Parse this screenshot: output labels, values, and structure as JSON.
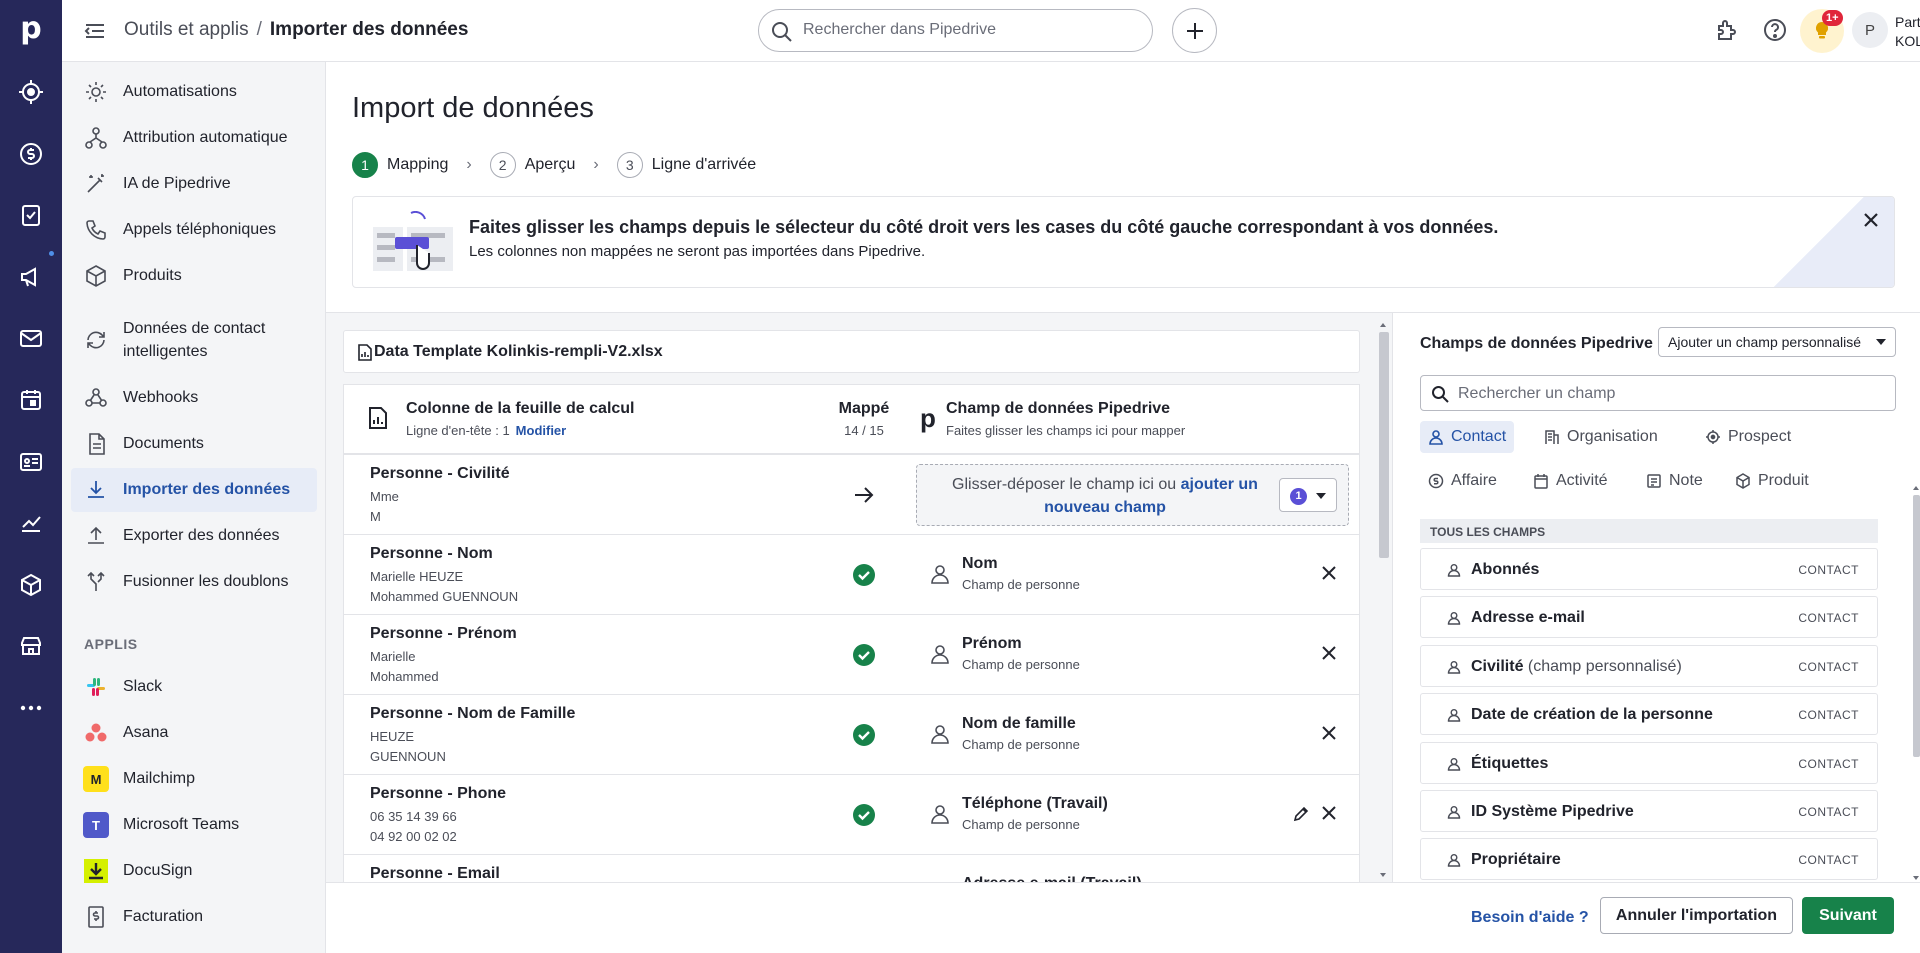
{
  "app": {
    "logo": "p"
  },
  "topbar": {
    "breadcrumb_parent": "Outils et applis",
    "breadcrumb_sep": "/",
    "breadcrumb_current": "Importer des données",
    "search_placeholder": "Rechercher dans Pipedrive",
    "notification_badge": "1+",
    "avatar_initial": "P",
    "user_line1": "Partner",
    "user_line2": "KOLINKIS"
  },
  "sidebar": {
    "items": [
      {
        "label": "Automatisations",
        "icon": "automation-icon"
      },
      {
        "label": "Attribution automatique",
        "icon": "assignment-icon"
      },
      {
        "label": "IA de Pipedrive",
        "icon": "magic-wand-icon"
      },
      {
        "label": "Appels téléphoniques",
        "icon": "phone-icon"
      },
      {
        "label": "Produits",
        "icon": "box-icon"
      },
      {
        "label": "Données de contact intelligentes",
        "icon": "sync-icon"
      },
      {
        "label": "Webhooks",
        "icon": "webhook-icon"
      },
      {
        "label": "Documents",
        "icon": "document-icon"
      },
      {
        "label": "Importer des données",
        "icon": "download-icon"
      },
      {
        "label": "Exporter des données",
        "icon": "upload-icon"
      },
      {
        "label": "Fusionner les doublons",
        "icon": "merge-icon"
      }
    ],
    "apps_heading": "APPLIS",
    "apps": [
      {
        "label": "Slack",
        "icon": "slack-icon"
      },
      {
        "label": "Asana",
        "icon": "asana-icon"
      },
      {
        "label": "Mailchimp",
        "icon": "mailchimp-icon"
      },
      {
        "label": "Microsoft Teams",
        "icon": "teams-icon"
      },
      {
        "label": "DocuSign",
        "icon": "docusign-icon"
      },
      {
        "label": "Facturation",
        "icon": "invoice-icon"
      }
    ]
  },
  "main": {
    "title": "Import de données",
    "steps": [
      {
        "num": "1",
        "label": "Mapping",
        "active": true
      },
      {
        "num": "2",
        "label": "Aperçu",
        "active": false
      },
      {
        "num": "3",
        "label": "Ligne d'arrivée",
        "active": false
      }
    ],
    "banner": {
      "title": "Faites glisser les champs depuis le sélecteur du côté droit vers les cases du côté gauche correspondant à vos données.",
      "subtitle": "Les colonnes non mappées ne seront pas importées dans Pipedrive."
    },
    "file_name": "Data Template Kolinkis-rempli-V2.xlsx",
    "table": {
      "col1_title": "Colonne de la feuille de calcul",
      "col1_sub": "Ligne d'en-tête : 1",
      "col1_link": "Modifier",
      "mapped_title": "Mappé",
      "mapped_count": "14 / 15",
      "col3_title": "Champ de données Pipedrive",
      "col3_sub": "Faites glisser les champs ici pour mapper",
      "drop_text": "Glisser-déposer le champ ici ou",
      "drop_link": "ajouter un nouveau champ",
      "drop_count": "1",
      "rows": [
        {
          "name": "Personne - Civilité",
          "v1": "Mme",
          "v2": "M",
          "mapped": false,
          "field": "",
          "field_type": ""
        },
        {
          "name": "Personne - Nom",
          "v1": "Marielle HEUZE",
          "v2": "Mohammed GUENNOUN",
          "mapped": true,
          "field": "Nom",
          "field_type": "Champ de personne"
        },
        {
          "name": "Personne - Prénom",
          "v1": "Marielle",
          "v2": "Mohammed",
          "mapped": true,
          "field": "Prénom",
          "field_type": "Champ de personne"
        },
        {
          "name": "Personne - Nom de Famille",
          "v1": "HEUZE",
          "v2": "GUENNOUN",
          "mapped": true,
          "field": "Nom de famille",
          "field_type": "Champ de personne"
        },
        {
          "name": "Personne - Phone",
          "v1": "06 35 14 39 66",
          "v2": "04 92 00 02 02",
          "mapped": true,
          "field": "Téléphone (Travail)",
          "field_type": "Champ de personne"
        },
        {
          "name": "Personne - Email",
          "v1": "",
          "v2": "",
          "mapped": true,
          "field": "Adresse e-mail (Travail)",
          "field_type": ""
        }
      ]
    }
  },
  "right_panel": {
    "title": "Champs de données Pipedrive",
    "custom_button": "Ajouter un champ personnalisé",
    "search_placeholder": "Rechercher un champ",
    "tabs": [
      "Contact",
      "Organisation",
      "Prospect",
      "Affaire",
      "Activité",
      "Note",
      "Produit"
    ],
    "all_fields_heading": "TOUS LES CHAMPS",
    "fields": [
      {
        "label": "Abonnés",
        "extra": "",
        "tag": "CONTACT"
      },
      {
        "label": "Adresse e-mail",
        "extra": "",
        "tag": "CONTACT"
      },
      {
        "label": "Civilité",
        "extra": "(champ personnalisé)",
        "tag": "CONTACT"
      },
      {
        "label": "Date de création de la personne",
        "extra": "",
        "tag": "CONTACT"
      },
      {
        "label": "Étiquettes",
        "extra": "",
        "tag": "CONTACT"
      },
      {
        "label": "ID Système Pipedrive",
        "extra": "",
        "tag": "CONTACT"
      },
      {
        "label": "Propriétaire",
        "extra": "",
        "tag": "CONTACT"
      }
    ]
  },
  "footer": {
    "help": "Besoin d'aide ?",
    "cancel": "Annuler l'importation",
    "next": "Suivant"
  }
}
